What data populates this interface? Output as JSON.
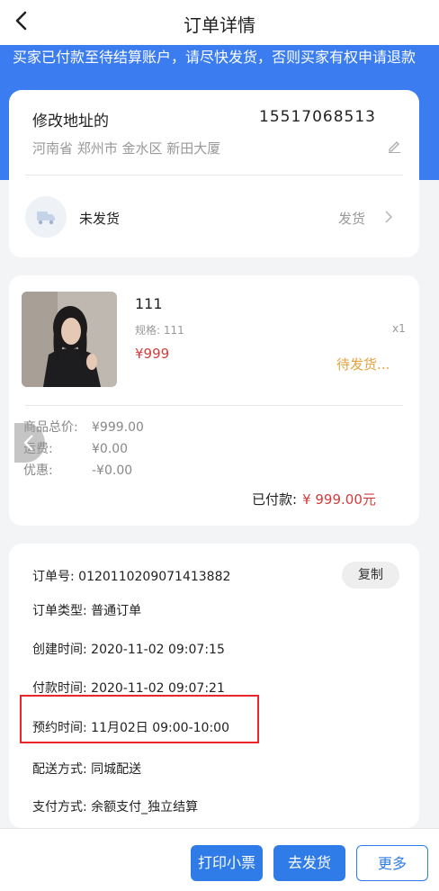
{
  "header": {
    "title": "订单详情"
  },
  "banner": {
    "text": "买家已付款至待结算账户，请尽快发货，否则买家有权申请退款"
  },
  "address": {
    "name": "修改地址的",
    "phone": "15517068513",
    "detail": "河南省 郑州市 金水区 新田大厦"
  },
  "shipping": {
    "status": "未发货",
    "action": "发货"
  },
  "product": {
    "name": "111",
    "spec": "规格: 111",
    "qty": "x1",
    "price": "¥999",
    "status": "待发货..."
  },
  "fees": [
    {
      "label": "商品总价:",
      "value": "¥999.00"
    },
    {
      "label": "运费:",
      "value": "¥0.00"
    },
    {
      "label": "优惠:",
      "value": "-¥0.00"
    }
  ],
  "paid": {
    "label": "已付款:",
    "amount": "¥ 999.00元"
  },
  "order_info": {
    "order_no": "订单号: 0120110209071413882",
    "copy_label": "复制",
    "order_type": "订单类型: 普通订单",
    "created": "创建时间: 2020-11-02 09:07:15",
    "paid_time": "付款时间: 2020-11-02 09:07:21",
    "reserve": "预约时间: 11月02日 09:00-10:00",
    "delivery": "配送方式: 同城配送",
    "payment": "支付方式: 余额支付_独立结算"
  },
  "actions": {
    "print": "打印小票",
    "ship": "去发货",
    "more": "更多"
  },
  "colors": {
    "primary": "#2f7ce8",
    "banner": "#3b7cf0",
    "price": "#d23c3c",
    "pending": "#e6a23c",
    "highlight": "#e8262b"
  },
  "icons": [
    "back-arrow-icon",
    "edit-pencil-icon",
    "truck-icon",
    "chevron-right-icon",
    "chevron-left-icon"
  ]
}
